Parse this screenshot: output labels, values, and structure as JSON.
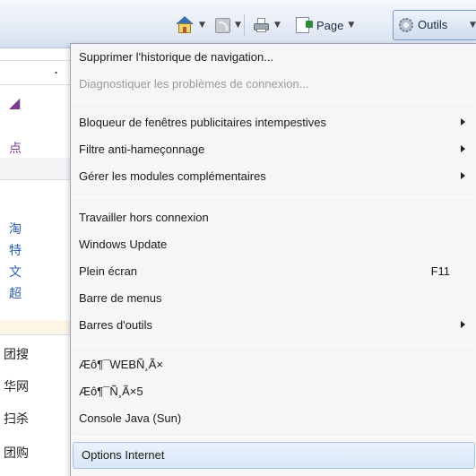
{
  "toolbar": {
    "page_label": "Page",
    "tools_label": "Outils"
  },
  "background": {
    "glyphs": [
      "点",
      "淘",
      "特",
      "文",
      "超",
      "团搜",
      "华网",
      "扫杀",
      "团购"
    ]
  },
  "menu": {
    "items": [
      {
        "label": "Supprimer l'historique de navigation..."
      },
      {
        "label": "Diagnostiquer les problèmes de connexion..."
      },
      {
        "label": "Bloqueur de fenêtres publicitaires intempestives"
      },
      {
        "label": "Filtre anti-hameçonnage"
      },
      {
        "label": "Gérer les modules complémentaires"
      },
      {
        "label": "Travailler hors connexion"
      },
      {
        "label": "Windows Update"
      },
      {
        "label": "Plein écran",
        "shortcut": "F11"
      },
      {
        "label": "Barre de menus"
      },
      {
        "label": "Barres d'outils"
      },
      {
        "label": "Æô¶¯WEBÑ¸Ã×"
      },
      {
        "label": "Æô¶¯Ñ¸Ã×5"
      },
      {
        "label": "Console Java (Sun)"
      },
      {
        "label": "Options Internet"
      }
    ]
  },
  "colors": {
    "menu_bg": "#f6f6f6",
    "hover_bg": "#d8e6f7",
    "disabled_text": "#9a9a9a",
    "toolbar_bg": "#e6ecf6"
  }
}
